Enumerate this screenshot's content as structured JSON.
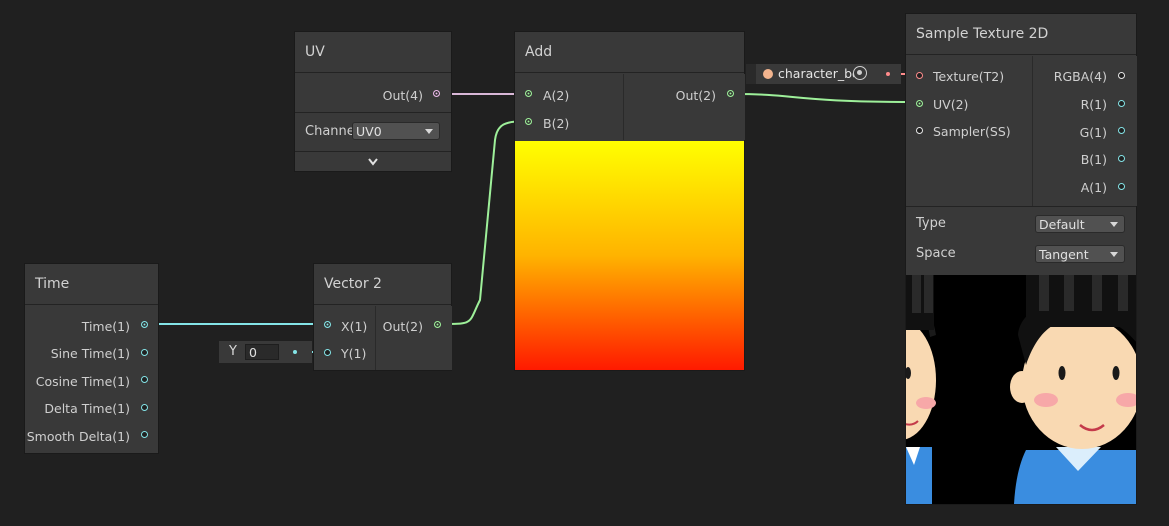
{
  "nodes": {
    "uv": {
      "title": "UV",
      "out_label": "Out(4)",
      "channel_label": "Channe",
      "channel_value": "UV0",
      "expand_icon": "chevron-down-icon"
    },
    "add": {
      "title": "Add",
      "in_a": "A(2)",
      "in_b": "B(2)",
      "out_label": "Out(2)",
      "preview_top_color": "#ffff00",
      "preview_bottom_color": "#ff1a00"
    },
    "sample_texture": {
      "title": "Sample Texture 2D",
      "inputs": [
        "Texture(T2)",
        "UV(2)",
        "Sampler(SS)"
      ],
      "outputs": [
        "RGBA(4)",
        "R(1)",
        "G(1)",
        "B(1)",
        "A(1)"
      ],
      "type_label": "Type",
      "type_value": "Default",
      "space_label": "Space",
      "space_value": "Tangent",
      "texture_field": "character_bo"
    },
    "time": {
      "title": "Time",
      "outputs": [
        "Time(1)",
        "Sine Time(1)",
        "Cosine Time(1)",
        "Delta Time(1)",
        "Smooth Delta(1)"
      ]
    },
    "vector2": {
      "title": "Vector 2",
      "in_x": "X(1)",
      "in_y": "Y(1)",
      "out_label": "Out(2)",
      "y_field_label": "Y",
      "y_field_value": "0"
    }
  },
  "colors": {
    "background": "#202020",
    "node_body": "#393939",
    "wire_float": "#84e4e7",
    "wire_vec2": "#9ef09a",
    "wire_vec4": "#eab9e8",
    "wire_texture": "#ff8b8b"
  }
}
